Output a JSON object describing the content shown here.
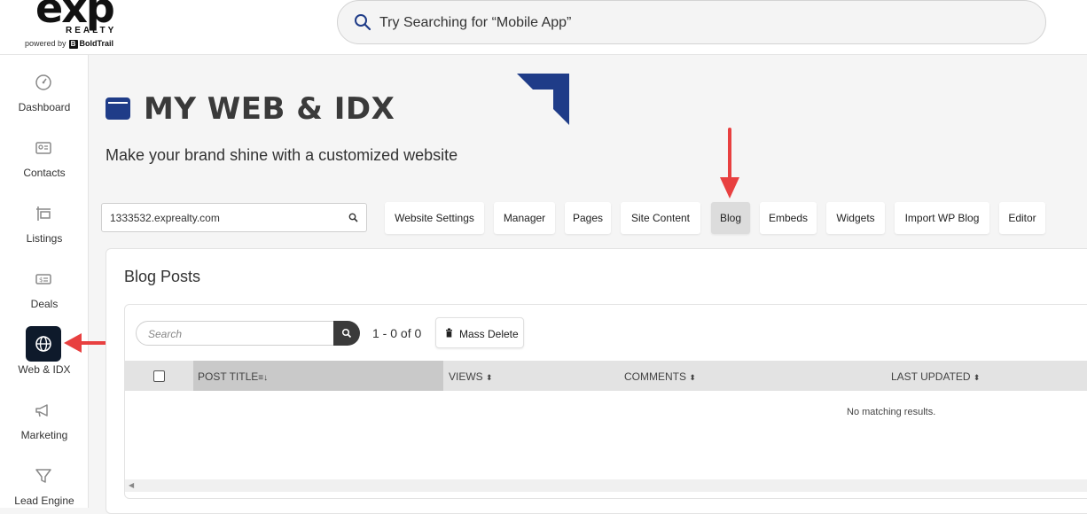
{
  "brand": {
    "logo_main": "exp",
    "logo_sub": "REALTY",
    "powered_prefix": "powered by",
    "powered_brand": "BoldTrail",
    "badge_letter": "B"
  },
  "search": {
    "placeholder": "Try Searching for “Mobile App”"
  },
  "sidebar": {
    "items": [
      {
        "label": "Dashboard",
        "icon": "gauge-icon"
      },
      {
        "label": "Contacts",
        "icon": "contact-card-icon"
      },
      {
        "label": "Listings",
        "icon": "sign-post-icon"
      },
      {
        "label": "Deals",
        "icon": "money-icon"
      },
      {
        "label": "Web & IDX",
        "icon": "globe-icon",
        "active": true
      },
      {
        "label": "Marketing",
        "icon": "megaphone-icon"
      },
      {
        "label": "Lead Engine",
        "icon": "funnel-icon"
      }
    ]
  },
  "page": {
    "title": "MY WEB & IDX",
    "subtitle": "Make your brand shine with a customized website"
  },
  "domain_field": {
    "value": "1333532.exprealty.com"
  },
  "tabs": [
    {
      "label": "Website Settings"
    },
    {
      "label": "Manager"
    },
    {
      "label": "Pages"
    },
    {
      "label": "Site Content"
    },
    {
      "label": "Blog",
      "active": true
    },
    {
      "label": "Embeds"
    },
    {
      "label": "Widgets"
    },
    {
      "label": "Import WP Blog"
    },
    {
      "label": "Editor"
    }
  ],
  "blog": {
    "title": "Blog Posts",
    "search_placeholder": "Search",
    "count": "1 - 0 of 0",
    "mass_delete": "Mass Delete",
    "columns": [
      {
        "label": "POST TITLE",
        "sort": "≡↓"
      },
      {
        "label": "VIEWS",
        "sort": "⌃⌄"
      },
      {
        "label": "COMMENTS",
        "sort": "⌃⌄"
      },
      {
        "label": "LAST UPDATED",
        "sort": "⌃⌄"
      }
    ],
    "empty_message": "No matching results."
  },
  "colors": {
    "accent": "#1f3c88",
    "active_nav": "#0e1a2b",
    "annotation_arrow": "#e84040"
  }
}
